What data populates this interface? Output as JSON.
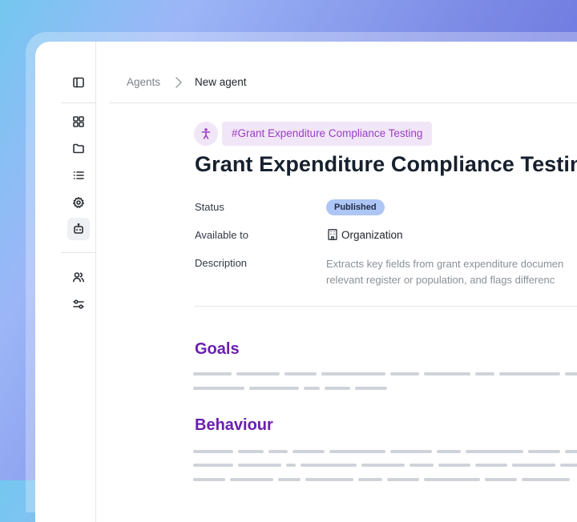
{
  "breadcrumb": {
    "root": "Agents",
    "current": "New agent"
  },
  "agent": {
    "tag": "#Grant Expenditure Compliance Testing",
    "title": "Grant Expenditure Compliance Testing",
    "properties": {
      "status_label": "Status",
      "status_value": "Published",
      "available_label": "Available to",
      "available_value": "Organization",
      "description_label": "Description",
      "description_line1": "Extracts key fields from grant expenditure documen",
      "description_line2": "relevant register or population, and flags differenc"
    }
  },
  "sections": {
    "goals": "Goals",
    "behaviour": "Behaviour"
  },
  "sidebar": {
    "icons": [
      "sidebar-toggle-icon",
      "dashboard-icon",
      "folder-icon",
      "list-icon",
      "settings-icon",
      "bot-icon",
      "users-icon",
      "sliders-icon"
    ],
    "active": "bot-icon"
  },
  "colors": {
    "accent_purple": "#6a1fae",
    "tag_text": "#9b3fc4",
    "tag_bg": "#f1e6f8",
    "badge_bg": "#aec6f5"
  }
}
